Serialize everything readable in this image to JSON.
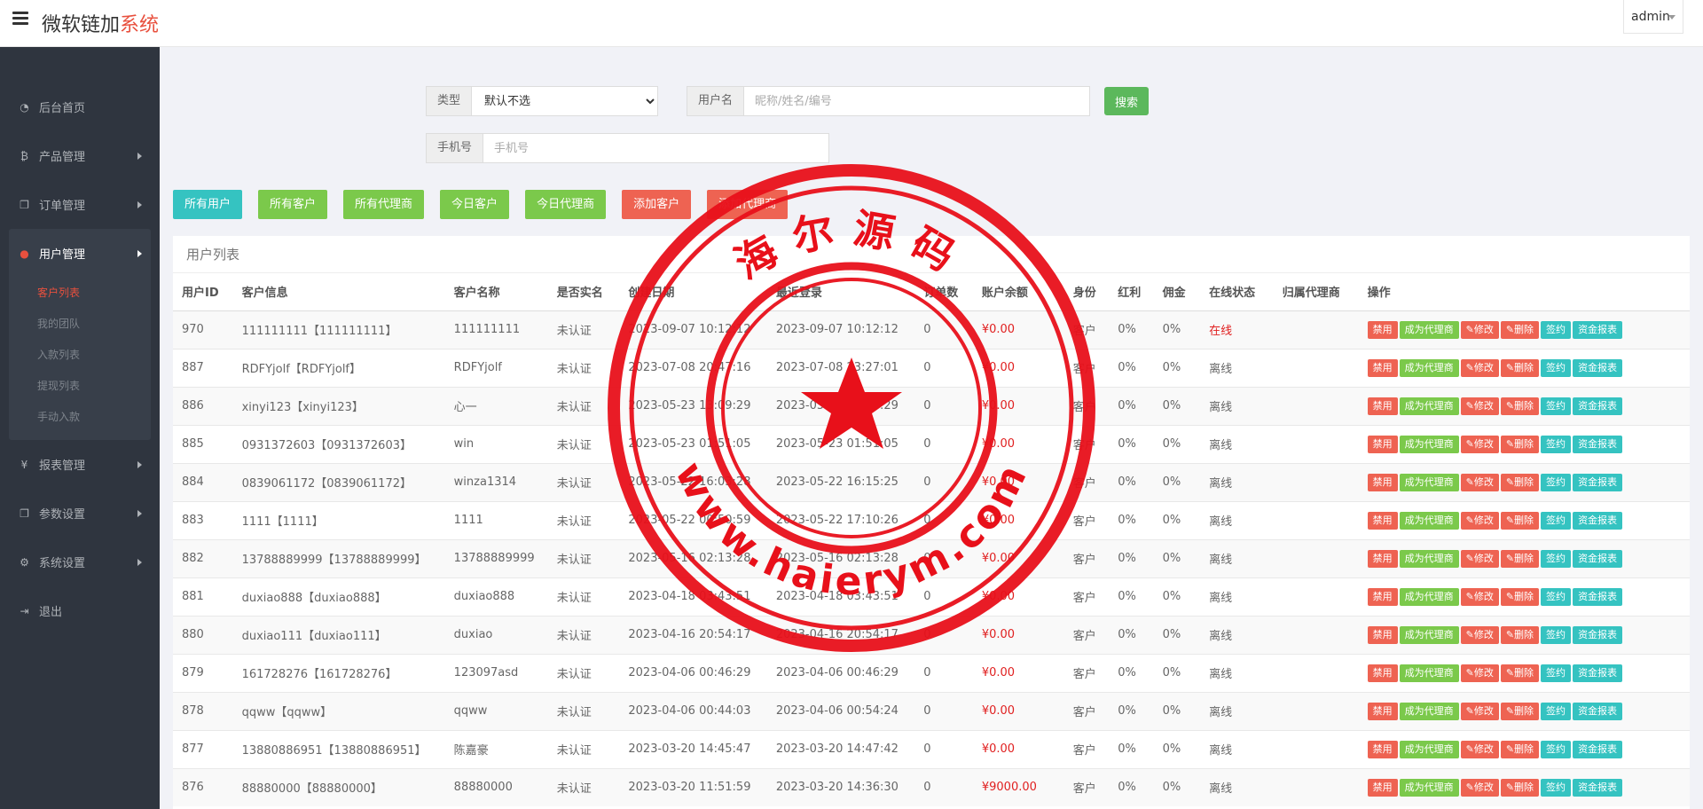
{
  "header": {
    "brand_main": "微软链加",
    "brand_accent": "系统",
    "user": "admin"
  },
  "sidebar": {
    "items": [
      {
        "label": "后台首页",
        "icon": "dashboard-icon"
      },
      {
        "label": "产品管理",
        "icon": "bitcoin-icon"
      },
      {
        "label": "订单管理",
        "icon": "copy-icon"
      }
    ],
    "active_group": {
      "label": "用户管理",
      "icon": "user-icon",
      "sub_items": [
        "客户列表",
        "我的团队",
        "入款列表",
        "提现列表",
        "手动入款"
      ]
    },
    "items_after": [
      {
        "label": "报表管理",
        "icon": "yen-icon"
      },
      {
        "label": "参数设置",
        "icon": "copy-icon"
      },
      {
        "label": "系统设置",
        "icon": "cogs-icon"
      },
      {
        "label": "退出",
        "icon": "sign-out-icon"
      }
    ]
  },
  "search": {
    "type_label": "类型",
    "type_selected": "默认不选",
    "username_label": "用户名",
    "username_placeholder": "昵称/姓名/编号",
    "search_button": "搜索",
    "phone_label": "手机号",
    "phone_placeholder": "手机号"
  },
  "filters": [
    {
      "label": "所有用户",
      "color": "#35c3c1"
    },
    {
      "label": "所有客户",
      "color": "#7bc94b"
    },
    {
      "label": "所有代理商",
      "color": "#7bc94b"
    },
    {
      "label": "今日客户",
      "color": "#7bc94b"
    },
    {
      "label": "今日代理商",
      "color": "#7bc94b"
    },
    {
      "label": "添加客户",
      "color": "#ee6352"
    },
    {
      "label": "添加代理商",
      "color": "#ee6352"
    }
  ],
  "table": {
    "title": "用户列表",
    "columns": [
      "用户ID",
      "客户信息",
      "客户名称",
      "是否实名",
      "创建日期",
      "最近登录",
      "订单数",
      "账户余额",
      "身份",
      "红利",
      "佣金",
      "在线状态",
      "归属代理商",
      "操作"
    ],
    "actions": [
      "禁用",
      "成为代理商",
      "✎修改",
      "✎删除",
      "签约",
      "资金报表"
    ],
    "rows": [
      [
        "970",
        "111111111【111111111】",
        "111111111",
        "未认证",
        "2023-09-07 10:12:12",
        "2023-09-07 10:12:12",
        "0",
        "¥0.00",
        "客户",
        "0%",
        "0%",
        "在线",
        ""
      ],
      [
        "887",
        "RDFYjolf【RDFYjolf】",
        "RDFYjolf",
        "未认证",
        "2023-07-08 20:47:16",
        "2023-07-08 23:27:01",
        "0",
        "¥0.00",
        "客户",
        "0%",
        "0%",
        "离线",
        ""
      ],
      [
        "886",
        "xinyi123【xinyi123】",
        "心一",
        "未认证",
        "2023-05-23 13:09:29",
        "2023-05-23 13:09:29",
        "0",
        "¥0.00",
        "客户",
        "0%",
        "0%",
        "离线",
        ""
      ],
      [
        "885",
        "0931372603【0931372603】",
        "win",
        "未认证",
        "2023-05-23 01:51:05",
        "2023-05-23 01:51:05",
        "0",
        "¥0.00",
        "客户",
        "0%",
        "0%",
        "离线",
        ""
      ],
      [
        "884",
        "0839061172【0839061172】",
        "winza1314",
        "未认证",
        "2023-05-22 16:03:28",
        "2023-05-22 16:15:25",
        "0",
        "¥0.00",
        "客户",
        "0%",
        "0%",
        "离线",
        ""
      ],
      [
        "883",
        "1111【1111】",
        "1111",
        "未认证",
        "2023-05-22 00:50:59",
        "2023-05-22 17:10:26",
        "0",
        "¥0.00",
        "客户",
        "0%",
        "0%",
        "离线",
        ""
      ],
      [
        "882",
        "13788889999【13788889999】",
        "13788889999",
        "未认证",
        "2023-05-16 02:13:28",
        "2023-05-16 02:13:28",
        "0",
        "¥0.00",
        "客户",
        "0%",
        "0%",
        "离线",
        ""
      ],
      [
        "881",
        "duxiao888【duxiao888】",
        "duxiao888",
        "未认证",
        "2023-04-18 03:43:51",
        "2023-04-18 03:43:51",
        "0",
        "¥0.00",
        "客户",
        "0%",
        "0%",
        "离线",
        ""
      ],
      [
        "880",
        "duxiao111【duxiao111】",
        "duxiao",
        "未认证",
        "2023-04-16 20:54:17",
        "2023-04-16 20:54:17",
        "0",
        "¥0.00",
        "客户",
        "0%",
        "0%",
        "离线",
        ""
      ],
      [
        "879",
        "161728276【161728276】",
        "123097asd",
        "未认证",
        "2023-04-06 00:46:29",
        "2023-04-06 00:46:29",
        "0",
        "¥0.00",
        "客户",
        "0%",
        "0%",
        "离线",
        ""
      ],
      [
        "878",
        "qqww【qqww】",
        "qqww",
        "未认证",
        "2023-04-06 00:44:03",
        "2023-04-06 00:54:24",
        "0",
        "¥0.00",
        "客户",
        "0%",
        "0%",
        "离线",
        ""
      ],
      [
        "877",
        "13880886951【13880886951】",
        "陈嘉豪",
        "未认证",
        "2023-03-20 14:45:47",
        "2023-03-20 14:47:42",
        "0",
        "¥0.00",
        "客户",
        "0%",
        "0%",
        "离线",
        ""
      ],
      [
        "876",
        "88880000【88880000】",
        "88880000",
        "未认证",
        "2023-03-20 11:51:59",
        "2023-03-20 14:36:30",
        "0",
        "¥9000.00",
        "客户",
        "0%",
        "0%",
        "离线",
        ""
      ]
    ]
  },
  "watermark": {
    "top_text": "海尔源码",
    "bottom_text": "www.haierym.com",
    "color": "#e8101a"
  }
}
